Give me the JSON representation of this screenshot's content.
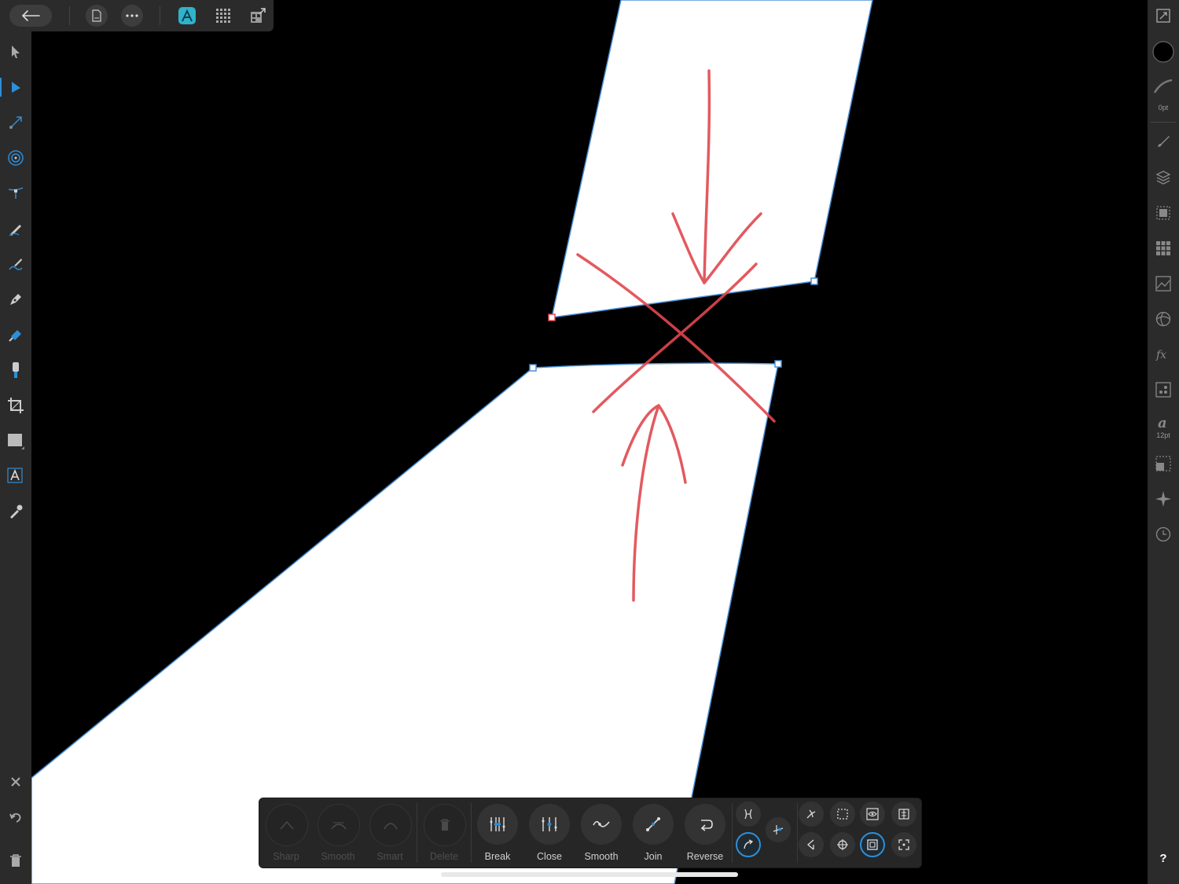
{
  "top_bar": {
    "back_icon": "arrow-left-icon",
    "document_icon": "document-icon",
    "more_icon": "more-icon",
    "persona_icon": "designer-persona-icon",
    "pixel_persona_icon": "pixel-persona-icon",
    "export_persona_icon": "export-persona-icon"
  },
  "left_tools": [
    {
      "name": "move-tool",
      "icon": "move-arrow-icon",
      "active": false
    },
    {
      "name": "node-tool",
      "icon": "node-arrow-icon",
      "active": true
    },
    {
      "name": "point-transform-tool",
      "icon": "point-transform-icon",
      "active": false
    },
    {
      "name": "contour-tool",
      "icon": "contour-icon",
      "active": false
    },
    {
      "name": "corner-tool",
      "icon": "corner-icon",
      "active": false
    },
    {
      "name": "pencil-tool",
      "icon": "pencil-icon",
      "active": false
    },
    {
      "name": "vector-brush-tool",
      "icon": "vector-brush-icon",
      "active": false
    },
    {
      "name": "pen-tool",
      "icon": "pen-icon",
      "active": false
    },
    {
      "name": "fill-tool",
      "icon": "fill-icon",
      "active": false
    },
    {
      "name": "transparency-tool",
      "icon": "transparency-icon",
      "active": false
    },
    {
      "name": "crop-tool",
      "icon": "crop-icon",
      "active": false
    },
    {
      "name": "rectangle-tool",
      "icon": "rectangle-icon",
      "active": false
    },
    {
      "name": "artistic-text-tool",
      "icon": "text-icon",
      "active": false
    },
    {
      "name": "color-picker-tool",
      "icon": "eyedropper-icon",
      "active": false
    }
  ],
  "left_bottom": {
    "close_icon": "close-icon",
    "undo_icon": "undo-icon",
    "trash_icon": "trash-icon"
  },
  "right_panel": {
    "stroke_width_label": "0pt",
    "font_size_label": "12pt",
    "help_label": "?",
    "fill_color": "#000000"
  },
  "context_toolbar": {
    "buttons": [
      {
        "label": "Sharp",
        "enabled": false
      },
      {
        "label": "Smooth",
        "enabled": false
      },
      {
        "label": "Smart",
        "enabled": false
      },
      {
        "label": "Delete",
        "enabled": false
      },
      {
        "label": "Break",
        "enabled": true
      },
      {
        "label": "Close",
        "enabled": true
      },
      {
        "label": "Smooth",
        "enabled": true
      },
      {
        "label": "Join",
        "enabled": true
      },
      {
        "label": "Reverse",
        "enabled": true
      }
    ]
  },
  "colors": {
    "accent": "#2d8fd8",
    "annotation": "#e0484e",
    "shape_fill": "#ffffff",
    "background": "#000000"
  }
}
